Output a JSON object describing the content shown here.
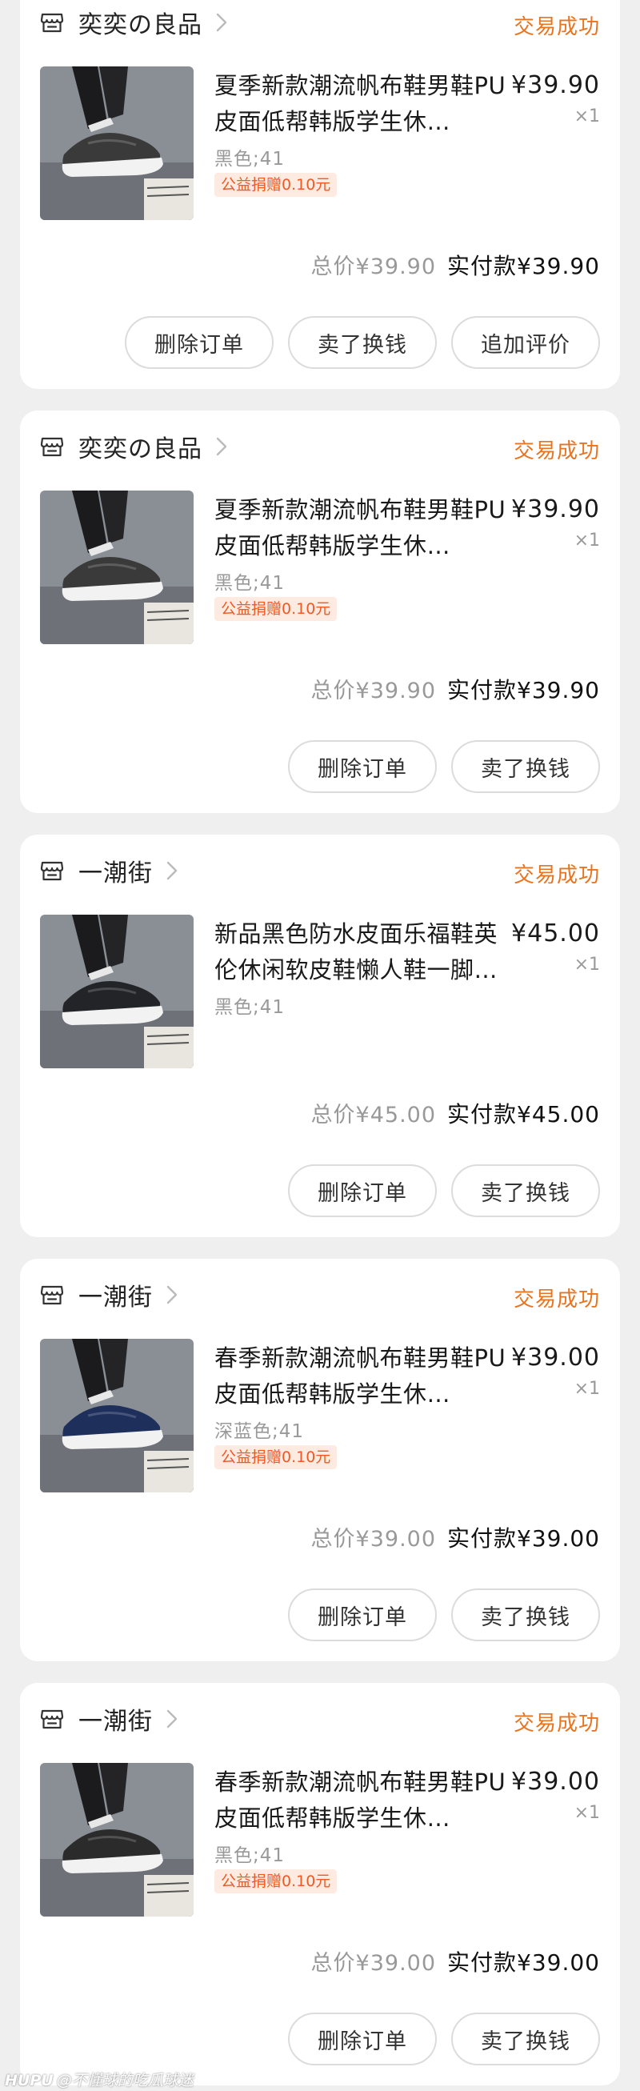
{
  "orders": [
    {
      "shop": "奕奕の良品",
      "status": "交易成功",
      "title": "夏季新款潮流帆布鞋男鞋PU皮面低帮韩版学生休…",
      "variant": "黑色;41",
      "charity": "公益捐赠0.10元",
      "unit_price": "¥39.90",
      "qty": "×1",
      "total": "总价¥39.90",
      "paid": "实付款¥39.90",
      "buttons": [
        "删除订单",
        "卖了换钱",
        "追加评价"
      ],
      "shoe_color": "#3a3a3a"
    },
    {
      "shop": "奕奕の良品",
      "status": "交易成功",
      "title": "夏季新款潮流帆布鞋男鞋PU皮面低帮韩版学生休…",
      "variant": "黑色;41",
      "charity": "公益捐赠0.10元",
      "unit_price": "¥39.90",
      "qty": "×1",
      "total": "总价¥39.90",
      "paid": "实付款¥39.90",
      "buttons": [
        "删除订单",
        "卖了换钱"
      ],
      "shoe_color": "#3a3a3a"
    },
    {
      "shop": "一潮街",
      "status": "交易成功",
      "title": "新品黑色防水皮面乐福鞋英伦休闲软皮鞋懒人鞋一脚…",
      "variant": "黑色;41",
      "charity": "",
      "unit_price": "¥45.00",
      "qty": "×1",
      "total": "总价¥45.00",
      "paid": "实付款¥45.00",
      "buttons": [
        "删除订单",
        "卖了换钱"
      ],
      "shoe_color": "#222428"
    },
    {
      "shop": "一潮街",
      "status": "交易成功",
      "title": "春季新款潮流帆布鞋男鞋PU皮面低帮韩版学生休…",
      "variant": "深蓝色;41",
      "charity": "公益捐赠0.10元",
      "unit_price": "¥39.00",
      "qty": "×1",
      "total": "总价¥39.00",
      "paid": "实付款¥39.00",
      "buttons": [
        "删除订单",
        "卖了换钱"
      ],
      "shoe_color": "#1f2f5c"
    },
    {
      "shop": "一潮街",
      "status": "交易成功",
      "title": "春季新款潮流帆布鞋男鞋PU皮面低帮韩版学生休…",
      "variant": "黑色;41",
      "charity": "公益捐赠0.10元",
      "unit_price": "¥39.00",
      "qty": "×1",
      "total": "总价¥39.00",
      "paid": "实付款¥39.00",
      "buttons": [
        "删除订单",
        "卖了换钱"
      ],
      "shoe_color": "#2b2b2b"
    }
  ],
  "icons": {
    "shop": "store-icon",
    "chevron": "chevron-right-icon"
  },
  "colors": {
    "status": "#e8741f",
    "charity_text": "#ee5a24",
    "charity_bg": "#fdebe2",
    "muted": "#999999"
  },
  "watermark": {
    "brand": "HUPU",
    "handle": "@不懂球的吃瓜球迷"
  }
}
